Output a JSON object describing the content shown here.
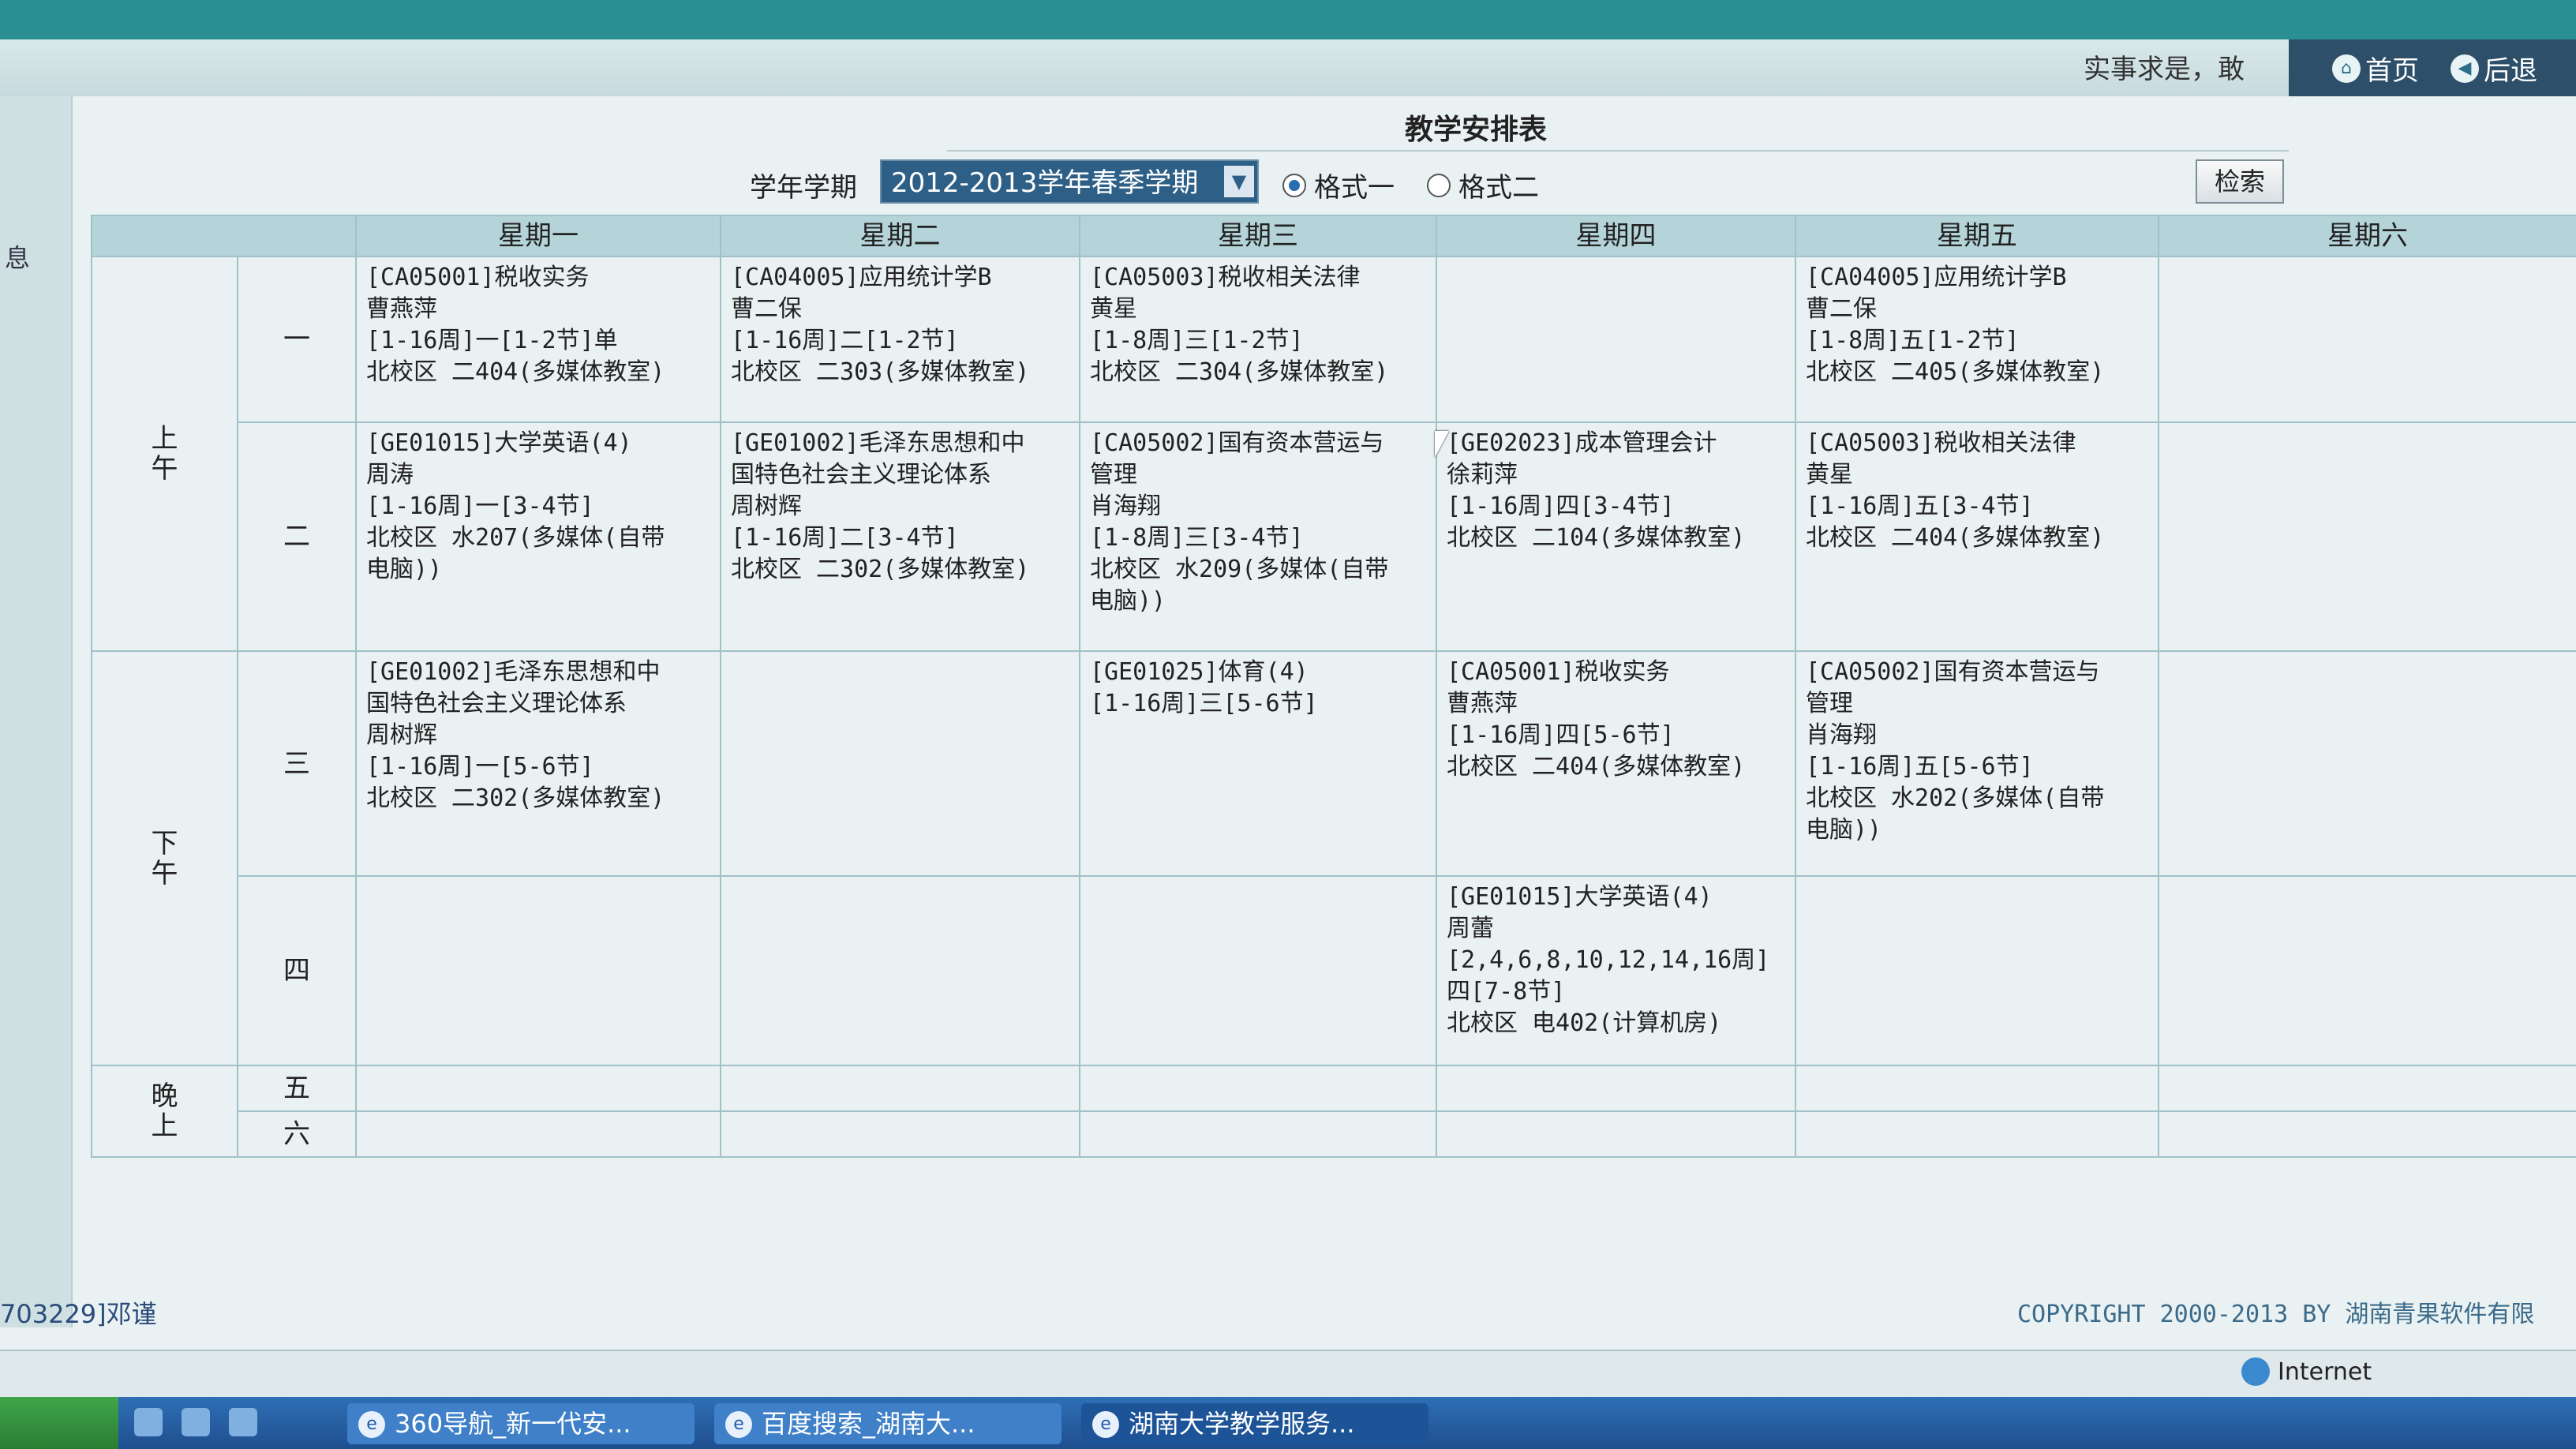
{
  "header": {
    "motto": "实事求是，敢",
    "nav": [
      {
        "label": "首页",
        "icon": "home-icon"
      },
      {
        "label": "后退",
        "icon": "back-icon"
      }
    ]
  },
  "sidebar": {
    "fragment": "息"
  },
  "page": {
    "title": "教学安排表",
    "term_label": "学年学期",
    "term_value": "2012-2013学年春季学期",
    "format1": "格式一",
    "format2": "格式二",
    "search_button": "检索"
  },
  "schedule": {
    "days": [
      "星期一",
      "星期二",
      "星期三",
      "星期四",
      "星期五",
      "星期六"
    ],
    "groups": {
      "morning": "上\n午",
      "afternoon": "下\n午",
      "evening": "晚\n上"
    },
    "periods": [
      "一",
      "二",
      "三",
      "四",
      "五",
      "六"
    ],
    "rows": [
      [
        [
          "[CA05001]税收实务",
          "曹燕萍",
          "[1-16周]一[1-2节]单",
          "北校区 二404(多媒体教室)"
        ],
        [
          "[CA04005]应用统计学B",
          "曹二保",
          "[1-16周]二[1-2节]",
          "北校区 二303(多媒体教室)"
        ],
        [
          "[CA05003]税收相关法律",
          "黄星",
          "[1-8周]三[1-2节]",
          "北校区 二304(多媒体教室)"
        ],
        [],
        [
          "[CA04005]应用统计学B",
          "曹二保",
          "[1-8周]五[1-2节]",
          "北校区 二405(多媒体教室)"
        ],
        []
      ],
      [
        [
          "[GE01015]大学英语(4)",
          "周涛",
          "[1-16周]一[3-4节]",
          "北校区 水207(多媒体(自带",
          "电脑))"
        ],
        [
          "[GE01002]毛泽东思想和中",
          "国特色社会主义理论体系",
          "周树辉",
          "[1-16周]二[3-4节]",
          "北校区 二302(多媒体教室)"
        ],
        [
          "[CA05002]国有资本营运与",
          "管理",
          "肖海翔",
          "[1-8周]三[3-4节]",
          "北校区 水209(多媒体(自带",
          "电脑))"
        ],
        [
          "[GE02023]成本管理会计",
          "徐莉萍",
          "[1-16周]四[3-4节]",
          "北校区 二104(多媒体教室)"
        ],
        [
          "[CA05003]税收相关法律",
          "黄星",
          "[1-16周]五[3-4节]",
          "北校区 二404(多媒体教室)"
        ],
        []
      ],
      [
        [
          "[GE01002]毛泽东思想和中",
          "国特色社会主义理论体系",
          "周树辉",
          "[1-16周]一[5-6节]",
          "北校区 二302(多媒体教室)"
        ],
        [],
        [
          "[GE01025]体育(4)",
          "[1-16周]三[5-6节]"
        ],
        [
          "[CA05001]税收实务",
          "曹燕萍",
          "[1-16周]四[5-6节]",
          "北校区 二404(多媒体教室)"
        ],
        [
          "[CA05002]国有资本营运与",
          "管理",
          "肖海翔",
          "[1-16周]五[5-6节]",
          "北校区 水202(多媒体(自带",
          "电脑))"
        ],
        []
      ],
      [
        [],
        [],
        [],
        [
          "[GE01015]大学英语(4)",
          "周蕾",
          "[2,4,6,8,10,12,14,16周]",
          "四[7-8节]",
          "北校区 电402(计算机房)"
        ],
        [],
        []
      ],
      [
        [],
        [],
        [],
        [],
        [],
        []
      ],
      [
        [],
        [],
        [],
        [],
        [],
        []
      ]
    ]
  },
  "footer": {
    "status_left": "703229]邓谨",
    "copyright": "COPYRIGHT 2000-2013 BY 湖南青果软件有限",
    "zone": "Internet"
  },
  "taskbar": {
    "items": [
      {
        "label": "360导航_新一代安...",
        "icon": "ie-icon"
      },
      {
        "label": "百度搜索_湖南大...",
        "icon": "ie-icon"
      },
      {
        "label": "湖南大学教学服务...",
        "icon": "ie-icon"
      }
    ]
  }
}
